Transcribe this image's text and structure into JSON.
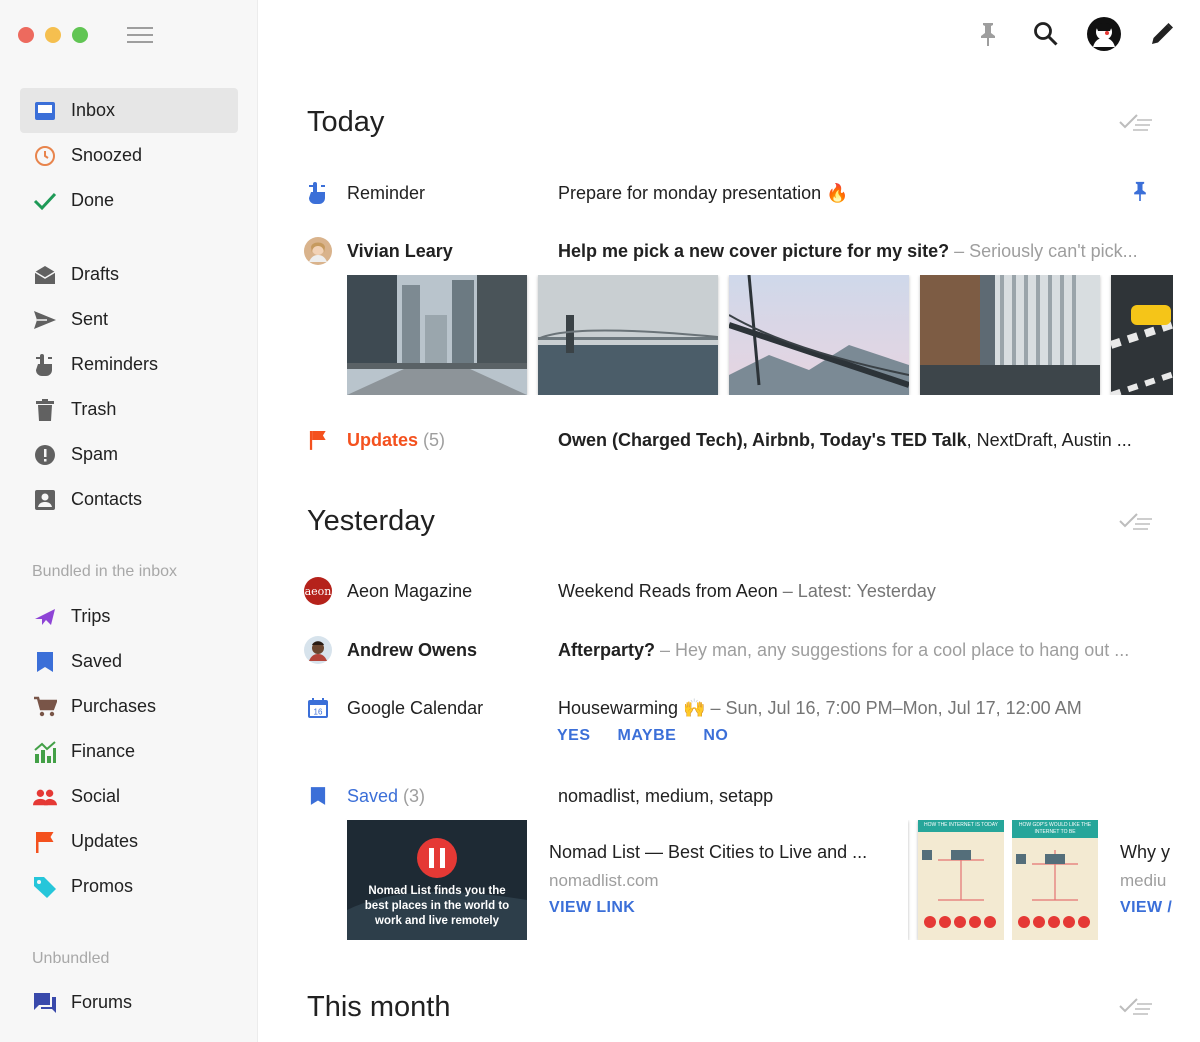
{
  "window": {
    "close_color": "#ed6a5e",
    "min_color": "#f5bf4f",
    "max_color": "#61c554"
  },
  "sidebar": {
    "primary": [
      {
        "label": "Inbox",
        "icon": "inbox-icon",
        "color": "#3b6fd8",
        "active": true
      },
      {
        "label": "Snoozed",
        "icon": "clock-icon",
        "color": "#e8844c"
      },
      {
        "label": "Done",
        "icon": "check-icon",
        "color": "#1e9a57"
      }
    ],
    "secondary": [
      {
        "label": "Drafts",
        "icon": "drafts-icon"
      },
      {
        "label": "Sent",
        "icon": "send-icon"
      },
      {
        "label": "Reminders",
        "icon": "reminder-icon"
      },
      {
        "label": "Trash",
        "icon": "trash-icon"
      },
      {
        "label": "Spam",
        "icon": "spam-icon"
      },
      {
        "label": "Contacts",
        "icon": "contacts-icon"
      }
    ],
    "bundled_header": "Bundled in the inbox",
    "bundled": [
      {
        "label": "Trips",
        "icon": "plane-icon",
        "color": "#8e44d6"
      },
      {
        "label": "Saved",
        "icon": "bookmark-icon",
        "color": "#3b6fd8"
      },
      {
        "label": "Purchases",
        "icon": "cart-icon",
        "color": "#795548"
      },
      {
        "label": "Finance",
        "icon": "finance-icon",
        "color": "#43a047"
      },
      {
        "label": "Social",
        "icon": "people-icon",
        "color": "#e53935"
      },
      {
        "label": "Updates",
        "icon": "flag-icon",
        "color": "#f4511e"
      },
      {
        "label": "Promos",
        "icon": "tag-icon",
        "color": "#26c6da"
      }
    ],
    "unbundled_header": "Unbundled",
    "unbundled": [
      {
        "label": "Forums",
        "icon": "forum-icon",
        "color": "#3949ab"
      }
    ]
  },
  "sections": {
    "today": "Today",
    "yesterday": "Yesterday",
    "this_month": "This month"
  },
  "today": {
    "reminder": {
      "sender": "Reminder",
      "subject": "Prepare for monday presentation 🔥"
    },
    "vivian": {
      "sender": "Vivian Leary",
      "subject": "Help me pick a new cover picture for my site?",
      "snippet": " – Seriously can't pick..."
    },
    "updates": {
      "sender": "Updates",
      "count": " (5)",
      "subject_bold": "Owen (Charged Tech), Airbnb, Today's TED Talk",
      "subject_rest": ", NextDraft, Austin ..."
    }
  },
  "yesterday": {
    "aeon": {
      "sender": "Aeon Magazine",
      "avatar_text": "aeon",
      "subject": "Weekend Reads from Aeon",
      "snippet": " – Latest: Yesterday"
    },
    "andrew": {
      "sender": "Andrew Owens",
      "subject": "Afterparty?",
      "snippet": " – Hey man, any suggestions for a cool place to hang out ..."
    },
    "calendar": {
      "sender": "Google Calendar",
      "calendar_day": "16",
      "subject": "Housewarming 🙌",
      "snippet": " – Sun, Jul 16, 7:00 PM–Mon, Jul 17, 12:00 AM",
      "yes": "YES",
      "maybe": "MAYBE",
      "no": "NO"
    },
    "saved": {
      "sender": "Saved",
      "count": " (3)",
      "subject": "nomadlist, medium, setapp"
    }
  },
  "cards": [
    {
      "image_text": "Nomad List finds you the best places in the world to work and live remotely",
      "title": "Nomad List — Best Cities to Live and ...",
      "domain": "nomadlist.com",
      "link": "VIEW LINK"
    },
    {
      "image_text_1": "HOW THE INTERNET IS TODAY",
      "image_text_2": "HOW GDP'S WOULD LIKE THE INTERNET TO BE",
      "title": "Why y",
      "domain": "mediu",
      "link": "VIEW /"
    }
  ]
}
